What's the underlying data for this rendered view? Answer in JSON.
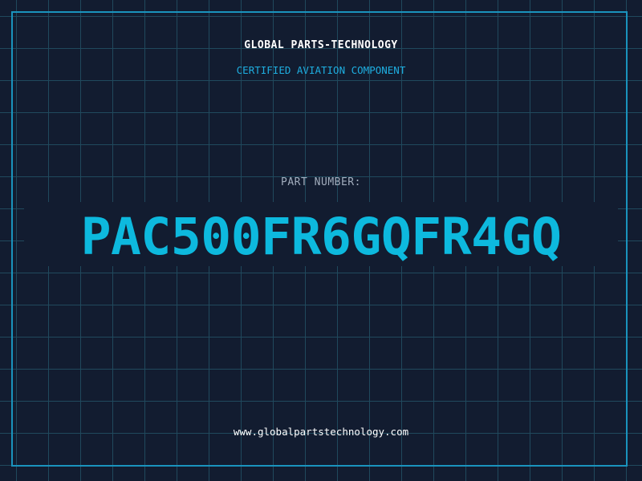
{
  "header": {
    "company": "GLOBAL PARTS-TECHNOLOGY",
    "subtitle": "CERTIFIED AVIATION COMPONENT"
  },
  "part": {
    "label": "PART NUMBER:",
    "number": "PAC500FR6GQFR4GQ"
  },
  "footer": {
    "website": "www.globalpartstechnology.com"
  },
  "colors": {
    "background": "#121c30",
    "grid": "#20495d",
    "frame": "#1a93bd",
    "accent": "#0db9de"
  }
}
